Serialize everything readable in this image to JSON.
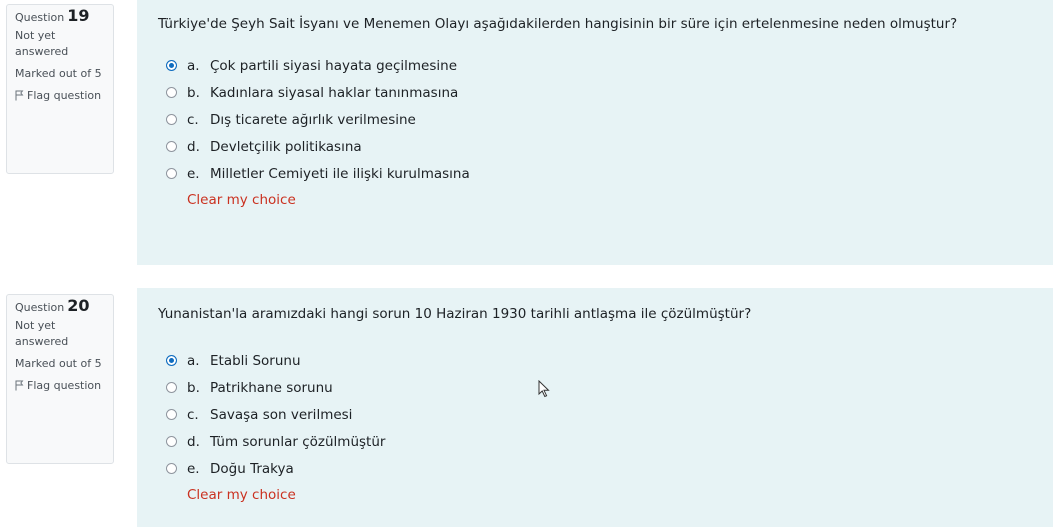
{
  "questions": [
    {
      "label": "Question",
      "number": "19",
      "state": "Not yet answered",
      "grade": "Marked out of 5",
      "flag_label": "Flag question",
      "text": "Türkiye'de Şeyh Sait İsyanı ve Menemen Olayı aşağıdakilerden hangisinin bir süre için ertelenmesine neden olmuştur?",
      "answers": [
        {
          "letter": "a.",
          "text": "Çok partili siyasi hayata geçilmesine",
          "selected": true
        },
        {
          "letter": "b.",
          "text": "Kadınlara siyasal haklar tanınmasına",
          "selected": false
        },
        {
          "letter": "c.",
          "text": "Dış ticarete ağırlık verilmesine",
          "selected": false
        },
        {
          "letter": "d.",
          "text": "Devletçilik politikasına",
          "selected": false
        },
        {
          "letter": "e.",
          "text": "Milletler Cemiyeti ile ilişki kurulmasına",
          "selected": false
        }
      ],
      "clear_label": "Clear my choice"
    },
    {
      "label": "Question",
      "number": "20",
      "state": "Not yet answered",
      "grade": "Marked out of 5",
      "flag_label": "Flag question",
      "text": "Yunanistan'la aramızdaki hangi sorun 10 Haziran 1930 tarihli antlaşma ile çözülmüştür?",
      "answers": [
        {
          "letter": "a.",
          "text": "Etabli Sorunu",
          "selected": true
        },
        {
          "letter": "b.",
          "text": "Patrikhane sorunu",
          "selected": false
        },
        {
          "letter": "c.",
          "text": "Savaşa son verilmesi",
          "selected": false
        },
        {
          "letter": "d.",
          "text": "Tüm sorunlar çözülmüştür",
          "selected": false
        },
        {
          "letter": "e.",
          "text": "Doğu Trakya",
          "selected": false
        }
      ],
      "clear_label": "Clear my choice"
    }
  ],
  "colors": {
    "accent": "#0f6cbf",
    "content_bg": "#e7f3f5",
    "clear_link": "#ca3120"
  }
}
